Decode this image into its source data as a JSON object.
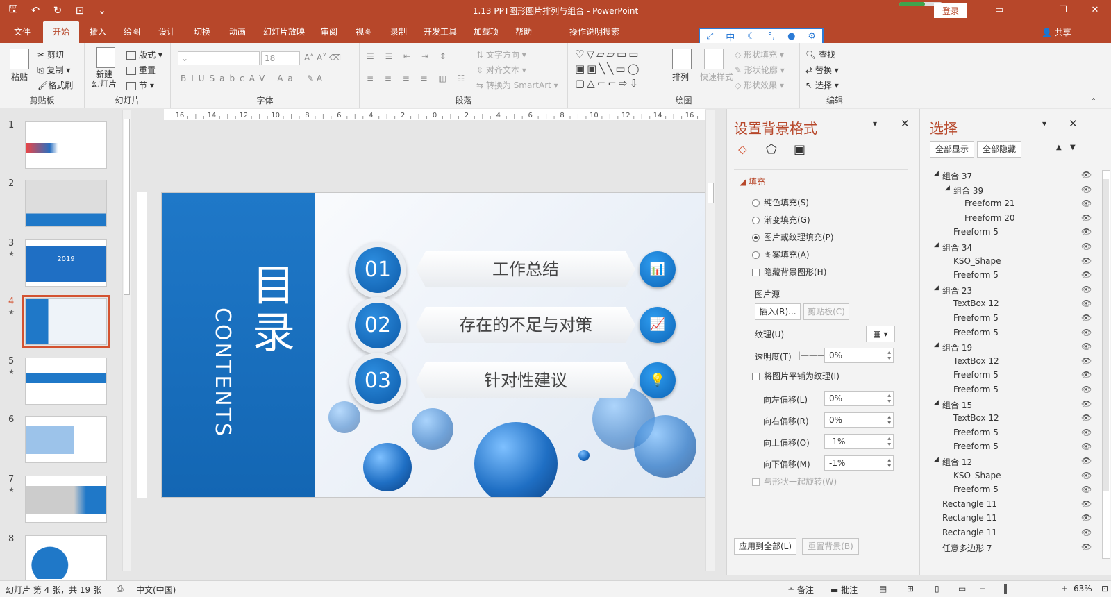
{
  "window": {
    "title": "1.13 PPT图形图片排列与组合  -  PowerPoint",
    "login": "登录",
    "share": "共享"
  },
  "tabs": [
    "文件",
    "开始",
    "插入",
    "绘图",
    "设计",
    "切换",
    "动画",
    "幻灯片放映",
    "审阅",
    "视图",
    "录制",
    "开发工具",
    "加载项",
    "帮助",
    "操作说明搜索"
  ],
  "active_tab": "开始",
  "ribbon": {
    "clipboard": {
      "label": "剪贴板",
      "paste": "粘贴",
      "cut": "剪切",
      "copy": "复制",
      "format_painter": "格式刷"
    },
    "slides": {
      "label": "幻灯片",
      "new_slide": "新建\n幻灯片",
      "layout": "版式",
      "reset": "重置",
      "section": "节"
    },
    "font": {
      "label": "字体",
      "size": "18"
    },
    "paragraph": {
      "label": "段落",
      "text_direction": "文字方向",
      "align_text": "对齐文本",
      "smartart": "转换为 SmartArt"
    },
    "drawing": {
      "label": "绘图",
      "arrange": "排列",
      "quick_styles": "快速样式",
      "shape_fill": "形状填充",
      "shape_outline": "形状轮廓",
      "shape_effects": "形状效果"
    },
    "editing": {
      "label": "编辑",
      "find": "查找",
      "replace": "替换",
      "select": "选择"
    }
  },
  "ruler_labels": [
    "16",
    "14",
    "12",
    "10",
    "8",
    "6",
    "4",
    "2",
    "0",
    "2",
    "4",
    "6",
    "8",
    "10",
    "12",
    "14",
    "16"
  ],
  "thumbnails": [
    {
      "num": "1",
      "star": false
    },
    {
      "num": "2",
      "star": false
    },
    {
      "num": "3",
      "star": true,
      "text": "2019"
    },
    {
      "num": "4",
      "star": true,
      "selected": true
    },
    {
      "num": "5",
      "star": true
    },
    {
      "num": "6",
      "star": false
    },
    {
      "num": "7",
      "star": true
    },
    {
      "num": "8",
      "star": false
    }
  ],
  "slide": {
    "title": "目录",
    "subtitle": "CONTENTS",
    "items": [
      {
        "num": "01",
        "label": "工作总结"
      },
      {
        "num": "02",
        "label": "存在的不足与对策"
      },
      {
        "num": "03",
        "label": "针对性建议"
      }
    ]
  },
  "format_pane": {
    "title": "设置背景格式",
    "section": "填充",
    "options": [
      {
        "label": "纯色填充(S)",
        "type": "radio",
        "checked": false
      },
      {
        "label": "渐变填充(G)",
        "type": "radio",
        "checked": false
      },
      {
        "label": "图片或纹理填充(P)",
        "type": "radio",
        "checked": true
      },
      {
        "label": "图案填充(A)",
        "type": "radio",
        "checked": false
      },
      {
        "label": "隐藏背景图形(H)",
        "type": "check",
        "checked": false
      }
    ],
    "picture_source": "图片源",
    "insert_btn": "插入(R)...",
    "clipboard_btn": "剪贴板(C)",
    "texture_label": "纹理(U)",
    "transparency_label": "透明度(T)",
    "transparency_value": "0%",
    "tile_label": "将图片平铺为纹理(I)",
    "offsets": [
      {
        "label": "向左偏移(L)",
        "value": "0%"
      },
      {
        "label": "向右偏移(R)",
        "value": "0%"
      },
      {
        "label": "向上偏移(O)",
        "value": "-1%"
      },
      {
        "label": "向下偏移(M)",
        "value": "-1%"
      }
    ],
    "rotate_label": "与形状一起旋转(W)",
    "apply_all": "应用到全部(L)",
    "reset_bg": "重置背景(B)"
  },
  "selection_pane": {
    "title": "选择",
    "show_all": "全部显示",
    "hide_all": "全部隐藏",
    "items": [
      {
        "label": "组合 37",
        "level": 0,
        "group": true
      },
      {
        "label": "组合 39",
        "level": 1,
        "group": true
      },
      {
        "label": "Freeform 21",
        "level": 2,
        "group": false
      },
      {
        "label": "Freeform 20",
        "level": 2,
        "group": false
      },
      {
        "label": "Freeform 5",
        "level": 1,
        "group": false
      },
      {
        "label": "组合 34",
        "level": 0,
        "group": true
      },
      {
        "label": "KSO_Shape",
        "level": 1,
        "group": false
      },
      {
        "label": "Freeform 5",
        "level": 1,
        "group": false
      },
      {
        "label": "组合 23",
        "level": 0,
        "group": true
      },
      {
        "label": "TextBox 12",
        "level": 1,
        "group": false
      },
      {
        "label": "Freeform 5",
        "level": 1,
        "group": false
      },
      {
        "label": "Freeform 5",
        "level": 1,
        "group": false
      },
      {
        "label": "组合 19",
        "level": 0,
        "group": true
      },
      {
        "label": "TextBox 12",
        "level": 1,
        "group": false
      },
      {
        "label": "Freeform 5",
        "level": 1,
        "group": false
      },
      {
        "label": "Freeform 5",
        "level": 1,
        "group": false
      },
      {
        "label": "组合 15",
        "level": 0,
        "group": true
      },
      {
        "label": "TextBox 12",
        "level": 1,
        "group": false
      },
      {
        "label": "Freeform 5",
        "level": 1,
        "group": false
      },
      {
        "label": "Freeform 5",
        "level": 1,
        "group": false
      },
      {
        "label": "组合 12",
        "level": 0,
        "group": true
      },
      {
        "label": "KSO_Shape",
        "level": 1,
        "group": false
      },
      {
        "label": "Freeform 5",
        "level": 1,
        "group": false
      },
      {
        "label": "Rectangle 11",
        "level": 0,
        "group": false
      },
      {
        "label": "Rectangle 11",
        "level": 0,
        "group": false
      },
      {
        "label": "Rectangle 11",
        "level": 0,
        "group": false
      },
      {
        "label": "任意多边形 7",
        "level": 0,
        "group": false
      }
    ]
  },
  "status": {
    "slide_info": "幻灯片 第 4 张，共 19 张",
    "language": "中文(中国)",
    "notes": "备注",
    "comments": "批注",
    "zoom": "63%"
  }
}
